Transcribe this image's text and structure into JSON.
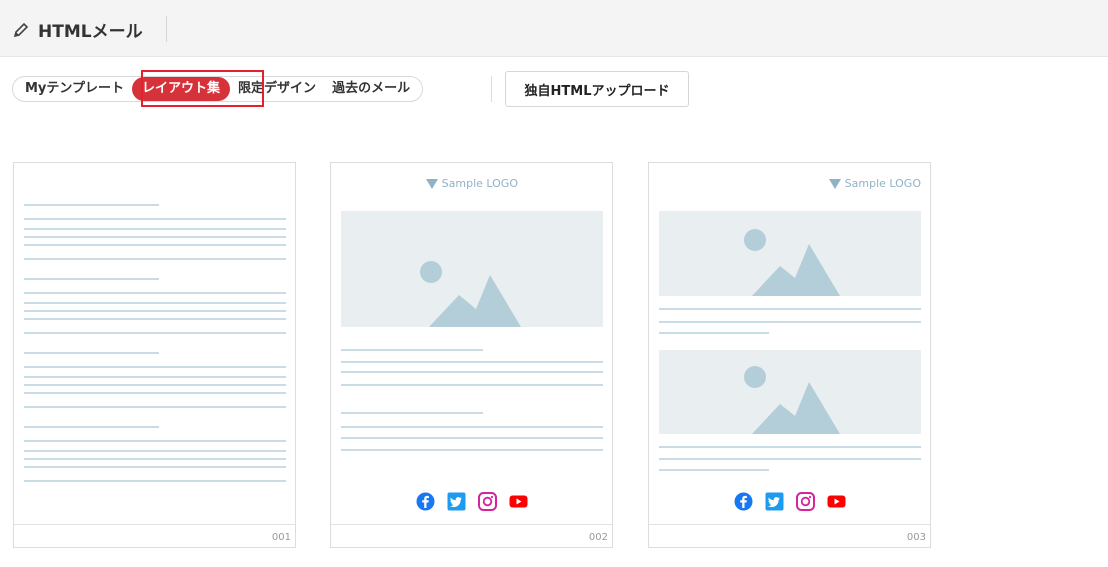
{
  "header": {
    "title": "HTMLメール"
  },
  "tabs": [
    {
      "label": "Myテンプレート",
      "active": false
    },
    {
      "label": "レイアウト集",
      "active": true
    },
    {
      "label": "限定デザイン",
      "active": false
    },
    {
      "label": "過去のメール",
      "active": false
    }
  ],
  "upload_label": "独自HTMLアップロード",
  "colors": {
    "accent": "#d6323a",
    "highlight": "#e3202c",
    "line": "#c9dbe4"
  },
  "templates": [
    {
      "number": "001",
      "logo": ""
    },
    {
      "number": "002",
      "logo": "Sample LOGO",
      "social": [
        "facebook-icon",
        "twitter-icon",
        "instagram-icon",
        "youtube-icon"
      ]
    },
    {
      "number": "003",
      "logo": "Sample LOGO",
      "social": [
        "facebook-icon",
        "twitter-icon",
        "instagram-icon",
        "youtube-icon"
      ]
    }
  ]
}
